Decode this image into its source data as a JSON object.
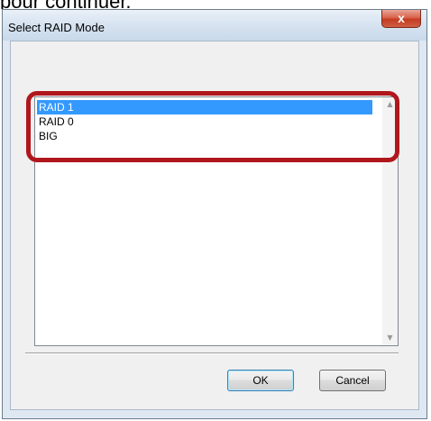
{
  "page": {
    "caption_fragment": "pour continuer."
  },
  "window": {
    "title": "Select RAID Mode",
    "close_label": "x"
  },
  "listbox": {
    "items": [
      {
        "label": "RAID 1",
        "selected": true
      },
      {
        "label": "RAID 0",
        "selected": false
      },
      {
        "label": "BIG",
        "selected": false
      }
    ],
    "scroll_up_icon": "triangle-up",
    "scroll_down_icon": "triangle-down"
  },
  "buttons": {
    "ok_label": "OK",
    "cancel_label": "Cancel"
  },
  "colors": {
    "highlight": "#b0171d",
    "selection": "#3399ff"
  }
}
